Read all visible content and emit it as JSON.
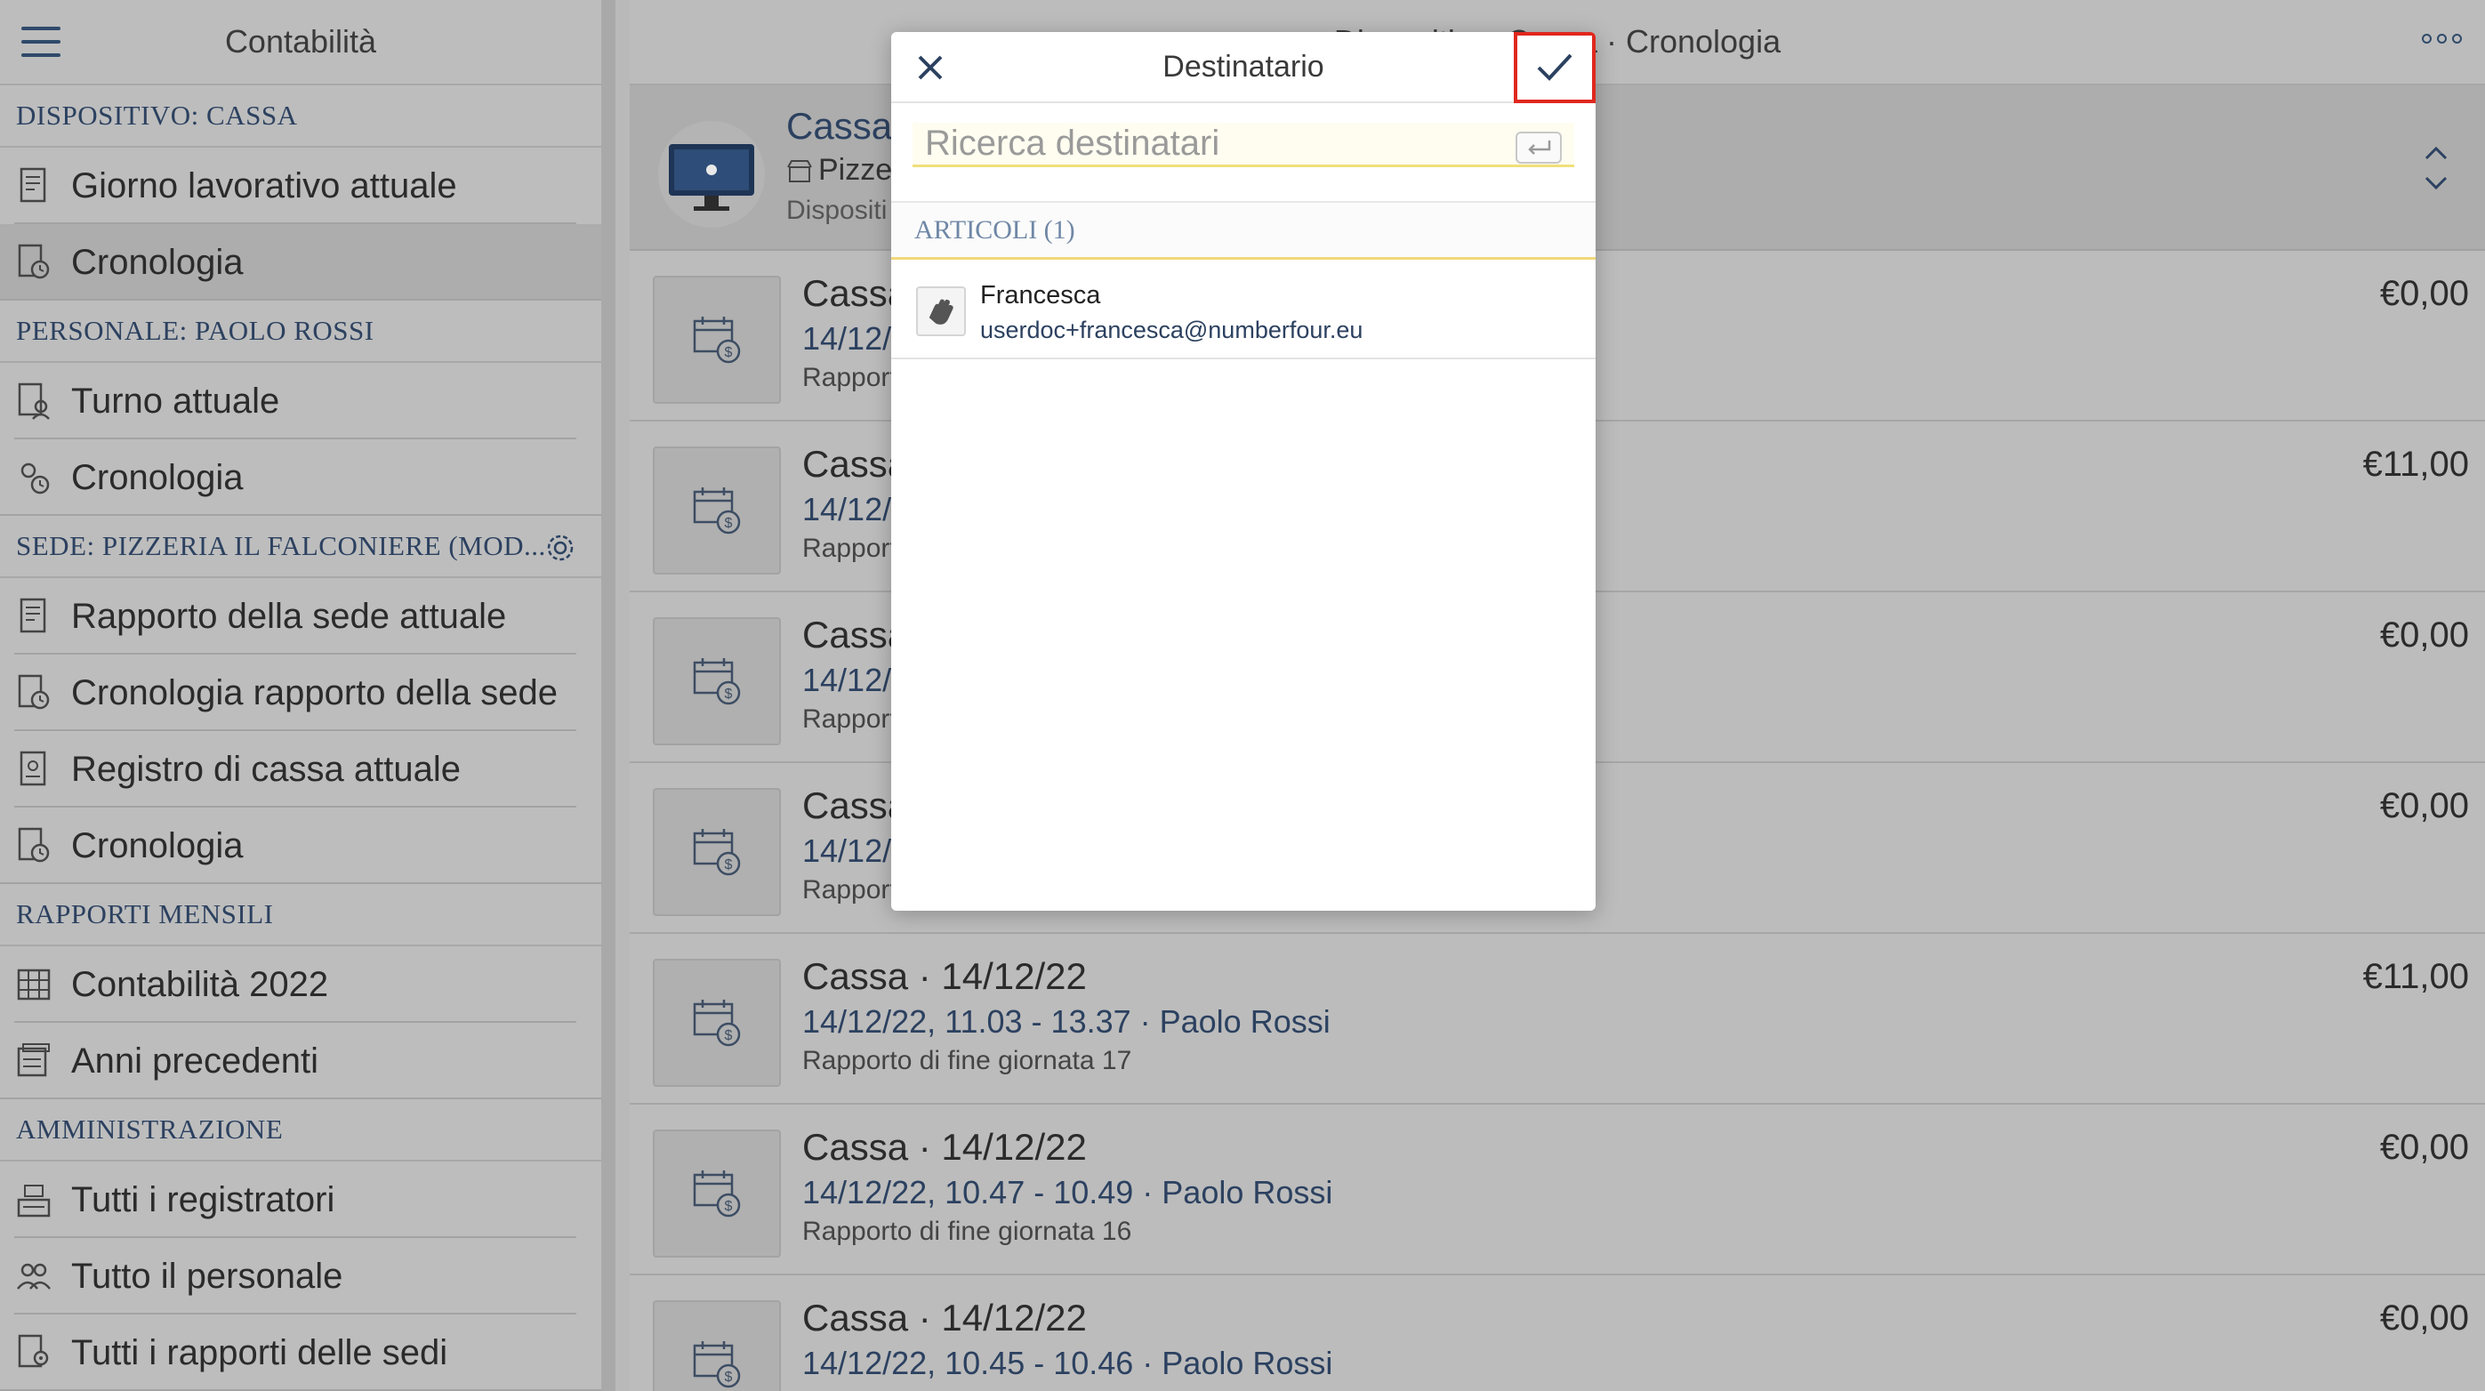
{
  "sidebar": {
    "title": "Contabilità",
    "sections": [
      {
        "title": "DISPOSITIVO: CASSA",
        "items": [
          {
            "label": "Giorno lavorativo attuale"
          },
          {
            "label": "Cronologia"
          }
        ]
      },
      {
        "title": "PERSONALE: PAOLO ROSSI",
        "items": [
          {
            "label": "Turno attuale"
          },
          {
            "label": "Cronologia"
          }
        ]
      },
      {
        "title": "SEDE: PIZZERIA IL FALCONIERE (MOD...",
        "items": [
          {
            "label": "Rapporto della sede attuale"
          },
          {
            "label": "Cronologia rapporto della sede"
          },
          {
            "label": "Registro di cassa attuale"
          },
          {
            "label": "Cronologia"
          }
        ]
      },
      {
        "title": "RAPPORTI MENSILI",
        "items": [
          {
            "label": "Contabilità 2022"
          },
          {
            "label": "Anni precedenti"
          }
        ]
      },
      {
        "title": "AMMINISTRAZIONE",
        "items": [
          {
            "label": "Tutti i registratori"
          },
          {
            "label": "Tutto il personale"
          },
          {
            "label": "Tutti i rapporti delle sedi"
          }
        ]
      }
    ]
  },
  "main": {
    "title": "Dispositivo: Cassa · Cronologia",
    "device": {
      "name": "Cassa",
      "location": "Pizze",
      "subtitle": "Dispositi"
    },
    "reports": [
      {
        "title": "Cassa",
        "line": "14/12/",
        "sub": "Rapport",
        "amount": "€0,00"
      },
      {
        "title": "Cassa",
        "line": "14/12/",
        "sub": "Rapport",
        "amount": "€11,00"
      },
      {
        "title": "Cassa",
        "line": "14/12/",
        "sub": "Rapport",
        "amount": "€0,00"
      },
      {
        "title": "Cassa",
        "line": "14/12/",
        "sub": "Rapport",
        "amount": "€0,00"
      },
      {
        "title": "Cassa · 14/12/22",
        "line": "14/12/22, 11.03 - 13.37 · Paolo Rossi",
        "sub": "Rapporto di fine giornata 17",
        "amount": "€11,00"
      },
      {
        "title": "Cassa · 14/12/22",
        "line": "14/12/22, 10.47 - 10.49 · Paolo Rossi",
        "sub": "Rapporto di fine giornata 16",
        "amount": "€0,00"
      },
      {
        "title": "Cassa · 14/12/22",
        "line": "14/12/22, 10.45 - 10.46 · Paolo Rossi",
        "sub": "",
        "amount": "€0,00"
      }
    ]
  },
  "modal": {
    "title": "Destinatario",
    "search_placeholder": "Ricerca destinatari",
    "section_title": "ARTICOLI (1)",
    "items": [
      {
        "name": "Francesca",
        "email": "userdoc+francesca@numberfour.eu"
      }
    ]
  },
  "colors": {
    "accent": "#2c4160",
    "highlight_border": "#e0281e"
  }
}
